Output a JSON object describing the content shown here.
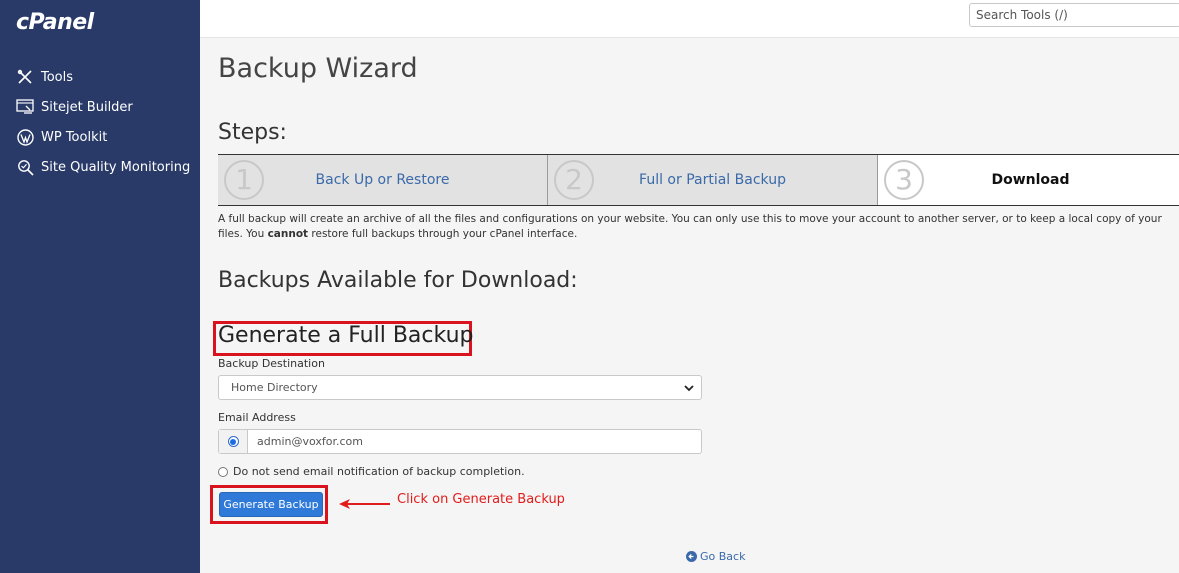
{
  "brand": {
    "logo": "cPanel"
  },
  "sidebar": {
    "items": [
      {
        "label": "Tools",
        "icon": "tools-icon"
      },
      {
        "label": "Sitejet Builder",
        "icon": "sitejet-icon"
      },
      {
        "label": "WP Toolkit",
        "icon": "wordpress-icon"
      },
      {
        "label": "Site Quality Monitoring",
        "icon": "search-quality-icon"
      }
    ]
  },
  "topbar": {
    "search_placeholder": "Search Tools (/)"
  },
  "main": {
    "title": "Backup Wizard",
    "steps_title": "Steps:",
    "steps": [
      {
        "num": "1",
        "label": "Back Up or Restore",
        "active": false
      },
      {
        "num": "2",
        "label": "Full or Partial Backup",
        "active": false
      },
      {
        "num": "3",
        "label": "Download",
        "active": true
      }
    ],
    "description_pre": "A full backup will create an archive of all the files and configurations on your website. You can only use this to move your account to another server, or to keep a local copy of your files. You ",
    "description_bold": "cannot",
    "description_post": " restore full backups through your cPanel interface.",
    "available_title": "Backups Available for Download:",
    "generate_title": "Generate a Full Backup",
    "destination_label": "Backup Destination",
    "destination_value": "Home Directory",
    "email_label": "Email Address",
    "email_value": "admin@voxfor.com",
    "no_email_label": "Do not send email notification of backup completion.",
    "generate_button": "Generate Backup",
    "annotation": "Click on Generate Backup",
    "go_back": "Go Back"
  },
  "colors": {
    "sidebar_bg": "#293a68",
    "primary_button": "#2f7ad8",
    "highlight_red": "#d9121e",
    "link_blue": "#3a6aa9"
  }
}
